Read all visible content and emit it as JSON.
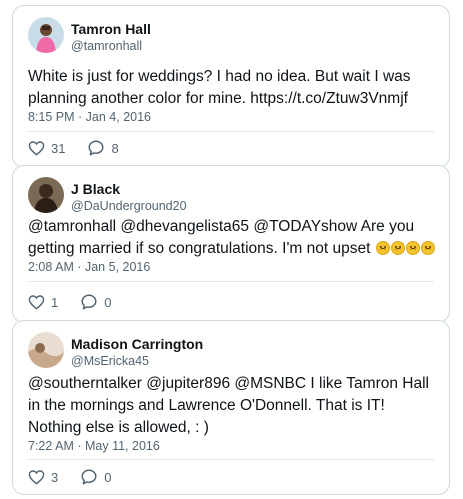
{
  "tweets": [
    {
      "name": "Tamron Hall",
      "handle": "@tamronhall",
      "text": "White is just for weddings? I had no idea. But wait I was planning another color for mine. https://t.co/Ztuw3Vnmjf",
      "time": "8:15 PM",
      "date": "Jan 4, 2016",
      "likes": "31",
      "replies": "8",
      "avatar_color": "#f06aa8"
    },
    {
      "name": "J Black",
      "handle": "@DaUnderground20",
      "text": "@tamronhall @dhevangelista65 @TODAYshow Are you getting married if so congratulations. I'm not upset",
      "emoji": [
        "confounded-face-icon",
        "confounded-face-icon",
        "confounded-face-icon",
        "confounded-face-icon"
      ],
      "time": "2:08 AM",
      "date": "Jan 5, 2016",
      "likes": "1",
      "replies": "0",
      "avatar_color": "#3b2a1f"
    },
    {
      "name": "Madison Carrington",
      "handle": "@MsEricka45",
      "text": "@southerntalker @jupiter896 @MSNBC I like Tamron Hall in the mornings and Lawrence O'Donnell. That is IT! Nothing else is allowed, : )",
      "time": "7:22 AM",
      "date": "May 11, 2016",
      "likes": "3",
      "replies": "0",
      "avatar_color": "#c9a98c"
    }
  ],
  "separator": " · ",
  "colors": {
    "text": "#0f1419",
    "secondary": "#536471",
    "border": "#cfd9de",
    "divider": "#e1e8ed"
  }
}
